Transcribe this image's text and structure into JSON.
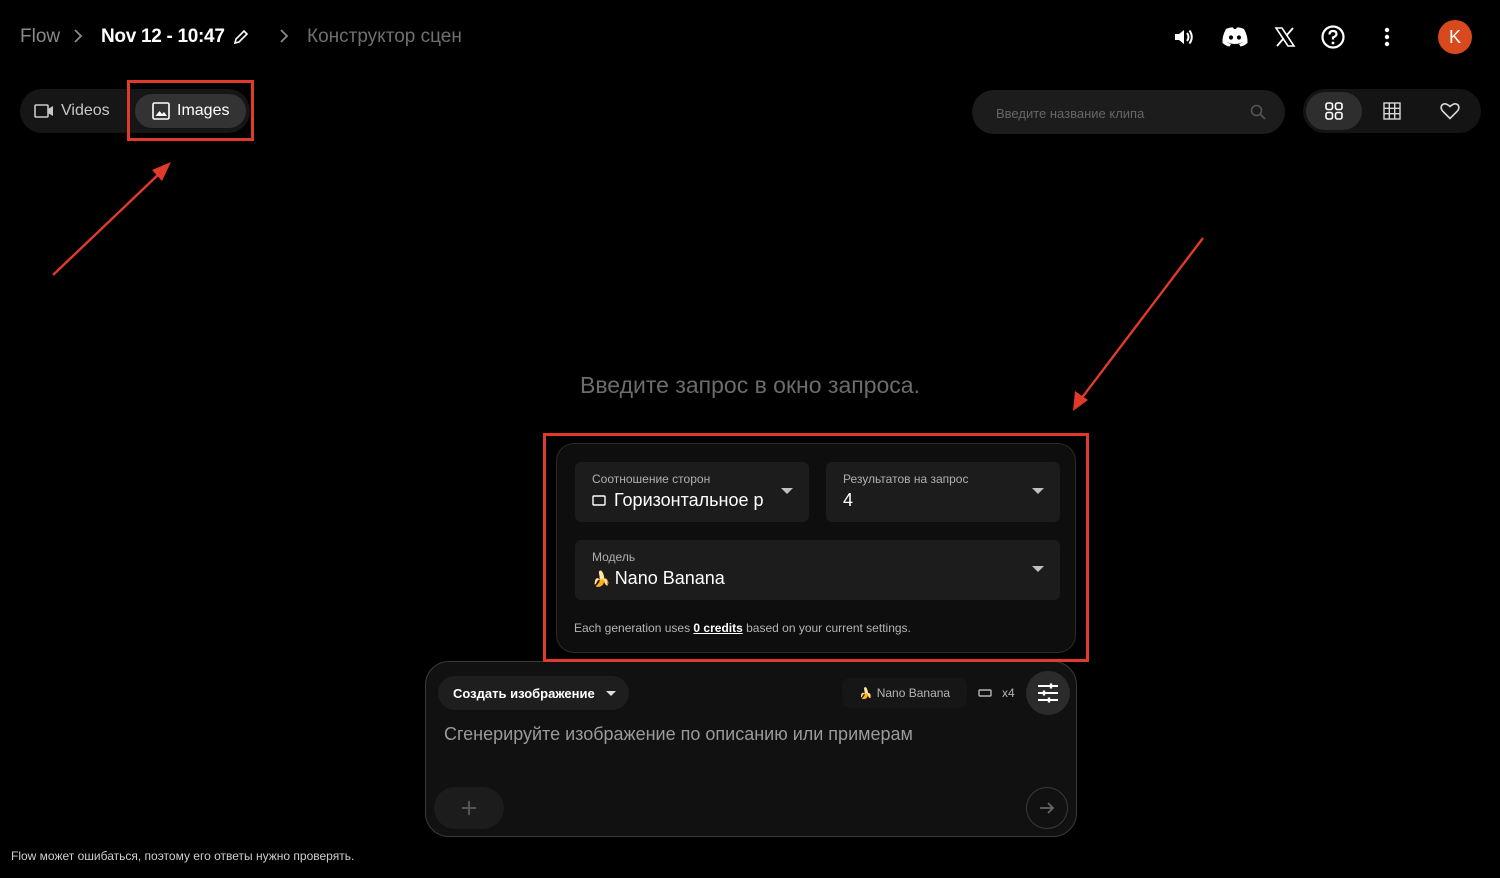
{
  "breadcrumb": {
    "root": "Flow",
    "separator": ">",
    "project_title": "Nov 12 - 10:47",
    "current": "Конструктор сцен"
  },
  "header_icons": [
    "speaker-icon",
    "discord-icon",
    "x-icon",
    "help-icon",
    "more-vert-icon"
  ],
  "avatar": {
    "initial": "K",
    "color": "#d9491e"
  },
  "media_tabs": [
    {
      "label": "Videos",
      "icon": "video-icon",
      "selected": false
    },
    {
      "label": "Images",
      "icon": "image-icon",
      "selected": true
    }
  ],
  "search": {
    "placeholder": "Введите название клипа",
    "value": ""
  },
  "view_toggle": [
    {
      "icon": "grid-large-icon",
      "selected": true
    },
    {
      "icon": "grid-small-icon",
      "selected": false
    },
    {
      "icon": "heart-icon",
      "selected": false
    }
  ],
  "empty_message": "Введите запрос в окно запроса.",
  "settings": {
    "aspect": {
      "label": "Соотношение сторон",
      "value": "Горизонтальное р",
      "icon": "landscape-icon"
    },
    "results": {
      "label": "Результатов на запрос",
      "value": "4"
    },
    "model": {
      "label": "Модель",
      "value": "Nano Banana",
      "icon": "🍌"
    },
    "credits": {
      "prefix": "Each generation uses ",
      "link": "0 credits",
      "suffix": " based on your current settings."
    }
  },
  "prompt": {
    "mode_label": "Создать изображение",
    "model_chip": "Nano Banana",
    "model_chip_icon": "🍌",
    "count_label": "x4",
    "placeholder": "Сгенерируйте изображение по описанию или примерам"
  },
  "disclaimer": "Flow может ошибаться, поэтому его ответы нужно проверять.",
  "colors": {
    "background": "#000000",
    "accent": "#d9491e",
    "annotation": "#e03b2a"
  }
}
